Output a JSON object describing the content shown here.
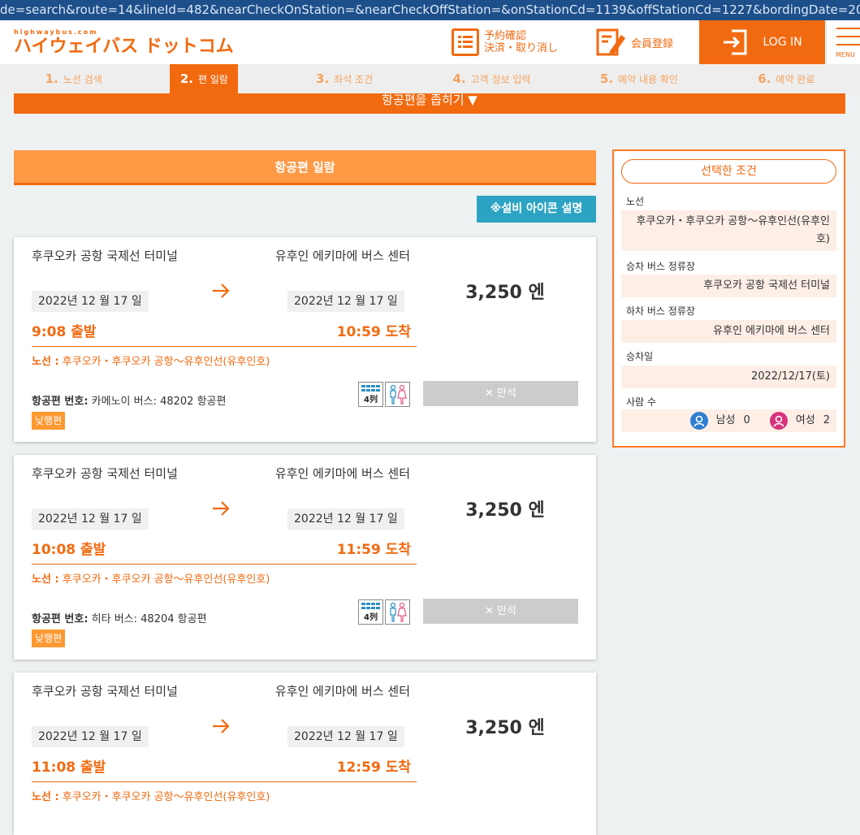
{
  "url": "de=search&route=14&lineId=482&nearCheckOnStation=&nearCheckOffStation=&onStationCd=1139&offStationCd=1227&bordingDate=20221217&danseiNum",
  "header": {
    "logo_small": "highwaybus.com",
    "logo_main": "ハイウェイバス ドットコム",
    "reservation_line1": "予約確認",
    "reservation_line2": "決済・取り消し",
    "member": "会員登録",
    "login": "LOG IN",
    "menu": "MENU"
  },
  "steps": [
    {
      "num": "1.",
      "label": "노선 검색"
    },
    {
      "num": "2.",
      "label": "편 일람"
    },
    {
      "num": "3.",
      "label": "좌석 조건"
    },
    {
      "num": "4.",
      "label": "고객 정보 입력"
    },
    {
      "num": "5.",
      "label": "예약 내용 확인"
    },
    {
      "num": "6.",
      "label": "예약 완료"
    }
  ],
  "narrow_button": "항공편을 좁히기 ▼",
  "list": {
    "heading": "항공편 일람",
    "legend_button": "※설비 아이콘 설명"
  },
  "cards": [
    {
      "from": "후쿠오카 공항 국제선 터미널",
      "to": "유후인 에키마에 버스 센터",
      "dep_date": "2022년 12 월 17 일",
      "arr_date": "2022년 12 월 17 일",
      "dep_time": "9:08 출발",
      "arr_time": "10:59 도착",
      "price": "3,250 엔",
      "route_label": "노선 :",
      "route_value": "후쿠오카・후쿠오카 공항～유후인선(유후인호)",
      "flight_label": "항공편 번호:",
      "flight_value": "카메노이 버스: 48202 항공편",
      "badge": "낮행편",
      "seat_icon": "4列",
      "full": "✕ 만석"
    },
    {
      "from": "후쿠오카 공항 국제선 터미널",
      "to": "유후인 에키마에 버스 센터",
      "dep_date": "2022년 12 월 17 일",
      "arr_date": "2022년 12 월 17 일",
      "dep_time": "10:08 출발",
      "arr_time": "11:59 도착",
      "price": "3,250 엔",
      "route_label": "노선 :",
      "route_value": "후쿠오카・후쿠오카 공항～유후인선(유후인호)",
      "flight_label": "항공편 번호:",
      "flight_value": "히타 버스: 48204 항공편",
      "badge": "낮행편",
      "seat_icon": "4列",
      "full": "✕ 만석"
    },
    {
      "from": "후쿠오카 공항 국제선 터미널",
      "to": "유후인 에키마에 버스 센터",
      "dep_date": "2022년 12 월 17 일",
      "arr_date": "2022년 12 월 17 일",
      "dep_time": "11:08 출발",
      "arr_time": "12:59 도착",
      "price": "3,250 엔",
      "route_label": "노선 :",
      "route_value": "후쿠오카・후쿠오카 공항～유후인선(유후인호)",
      "flight_label": "",
      "flight_value": "",
      "badge": "",
      "seat_icon": "",
      "full": ""
    }
  ],
  "sidebar": {
    "title": "선택한 조건",
    "route_label": "노선",
    "route_value": "후쿠오카・후쿠오카 공항～유후인선(유후인호)",
    "board_label": "승차 버스 정류장",
    "board_value": "후쿠오카 공항 국제선 터미널",
    "alight_label": "하차 버스 정류장",
    "alight_value": "유후인 에키마에 버스 센터",
    "date_label": "승차일",
    "date_value": "2022/12/17(토)",
    "people_label": "사람 수",
    "male_label": "남성",
    "male_count": "0",
    "female_label": "여성",
    "female_count": "2"
  },
  "colors": {
    "brand_orange": "#f26a10",
    "header_bar": "#ff9944",
    "legend_blue": "#2ca3c2",
    "full_grey": "#cccccc",
    "male_blue": "#2f7fd0",
    "female_pink": "#d6337a"
  }
}
